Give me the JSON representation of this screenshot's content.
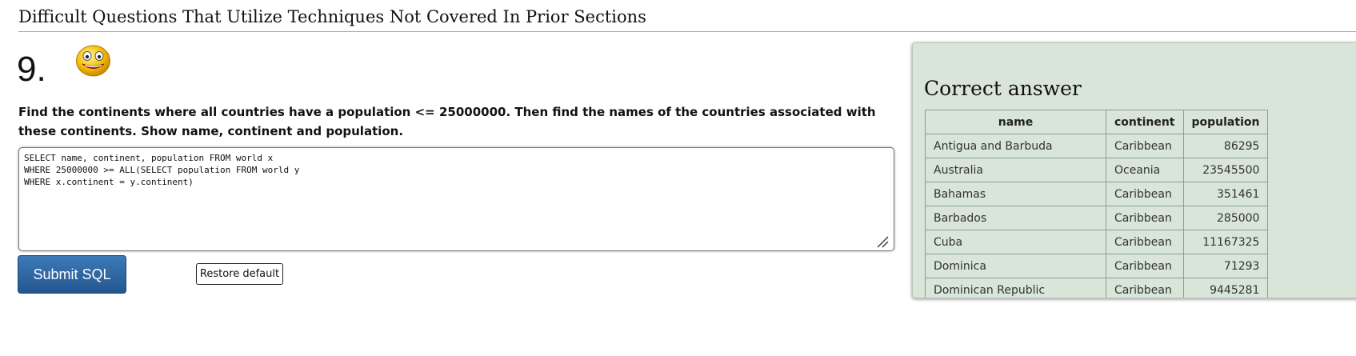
{
  "section": {
    "title": "Difficult Questions That Utilize Techniques Not Covered In Prior Sections"
  },
  "question": {
    "number": "9.",
    "status_icon": "smiley-face-icon",
    "text": "Find the continents where all countries have a population <= 25000000. Then find the names of the countries associated with these continents. Show name, continent and population.",
    "sql": "SELECT name, continent, population FROM world x\nWHERE 25000000 >= ALL(SELECT population FROM world y\nWHERE x.continent = y.continent)"
  },
  "buttons": {
    "submit_label": "Submit SQL",
    "restore_label": "Restore default"
  },
  "answer": {
    "title": "Correct answer",
    "columns": [
      "name",
      "continent",
      "population"
    ],
    "rows": [
      [
        "Antigua and Barbuda",
        "Caribbean",
        "86295"
      ],
      [
        "Australia",
        "Oceania",
        "23545500"
      ],
      [
        "Bahamas",
        "Caribbean",
        "351461"
      ],
      [
        "Barbados",
        "Caribbean",
        "285000"
      ],
      [
        "Cuba",
        "Caribbean",
        "11167325"
      ],
      [
        "Dominica",
        "Caribbean",
        "71293"
      ],
      [
        "Dominican Republic",
        "Caribbean",
        "9445281"
      ]
    ]
  },
  "colors": {
    "submit_bg": "#2f68a3",
    "answer_panel_bg": "#d8e5d8"
  }
}
